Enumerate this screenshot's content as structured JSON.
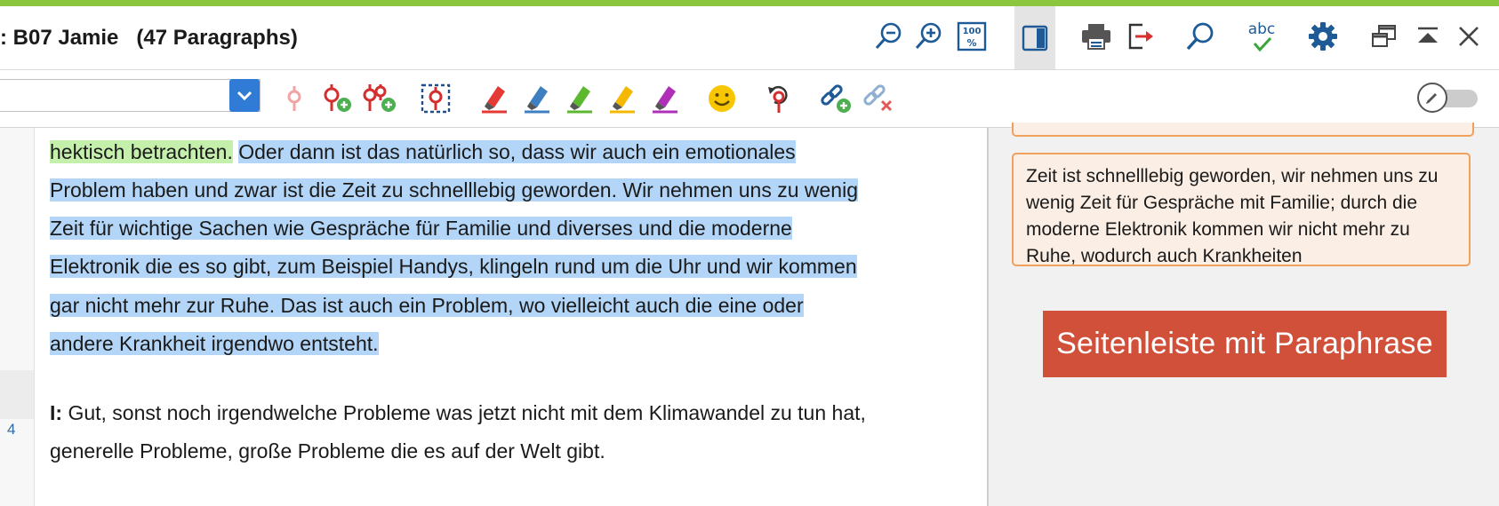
{
  "document": {
    "title": ": B07 Jamie   (47 Paragraphs)",
    "lines": [
      {
        "segments": [
          {
            "text": "hektisch betrachten.",
            "highlight": "green"
          },
          {
            "text": " ",
            "highlight": "none"
          },
          {
            "text": "Oder dann ist das natürlich so, dass wir auch ein emotionales",
            "highlight": "blue"
          }
        ]
      },
      {
        "segments": [
          {
            "text": "Problem haben und zwar ist die Zeit zu schnelllebig geworden. Wir nehmen uns zu wenig",
            "highlight": "blue"
          }
        ]
      },
      {
        "segments": [
          {
            "text": "Zeit für wichtige Sachen wie Gespräche für Familie und diverses und die moderne",
            "highlight": "blue"
          }
        ]
      },
      {
        "segments": [
          {
            "text": "Elektronik die es so gibt, zum Beispiel Handys, klingeln rund um die Uhr und wir kommen",
            "highlight": "blue"
          }
        ]
      },
      {
        "segments": [
          {
            "text": "gar nicht mehr zur Ruhe. Das ist auch ein Problem, wo vielleicht auch die eine oder",
            "highlight": "blue"
          }
        ]
      },
      {
        "segments": [
          {
            "text": "andere Krankheit irgendwo entsteht.",
            "highlight": "blue"
          }
        ]
      }
    ],
    "paragraph_number": "4",
    "interviewer_label": "I:",
    "interviewer_line1": " Gut, sonst noch irgendwelche Probleme was jetzt nicht mit dem Klimawandel zu tun hat,",
    "interviewer_line2": "generelle Probleme, große Probleme die es auf der Welt gibt."
  },
  "sidebar": {
    "paraphrase_memo": "Zeit ist schnelllebig geworden, wir nehmen uns zu wenig Zeit für Gespräche mit Familie; durch die moderne Elektronik kommen wir nicht mehr zu Ruhe, wodurch auch Krankheiten",
    "banner": "Seitenleiste mit Paraphrase"
  },
  "toolbar": {
    "code_select_value": "",
    "edit_mode": "off"
  },
  "colors": {
    "accent_bar": "#8cc63f",
    "highlight_green": "#c5f0ac",
    "highlight_blue": "#b3d5f7",
    "memo_border": "#f0a15c",
    "memo_fill": "#fbeee4",
    "banner": "#d0503a",
    "dropdown": "#2f7bd6"
  },
  "icons": {
    "window": [
      "zoom-out-icon",
      "zoom-in-icon",
      "zoom-100-icon",
      "sidebar-toggle-icon",
      "print-icon",
      "export-icon",
      "search-icon",
      "spellcheck-icon",
      "settings-gear-icon",
      "undock-window-icon",
      "collapse-up-icon",
      "close-icon"
    ],
    "coding": [
      "code-icon",
      "code-add-icon",
      "code-multi-add-icon",
      "code-selection-icon",
      "highlighter-red-icon",
      "highlighter-blue-icon",
      "highlighter-green-icon",
      "highlighter-yellow-icon",
      "highlighter-magenta-icon",
      "emoticon-icon",
      "undo-code-icon",
      "link-add-icon",
      "link-remove-icon"
    ]
  }
}
